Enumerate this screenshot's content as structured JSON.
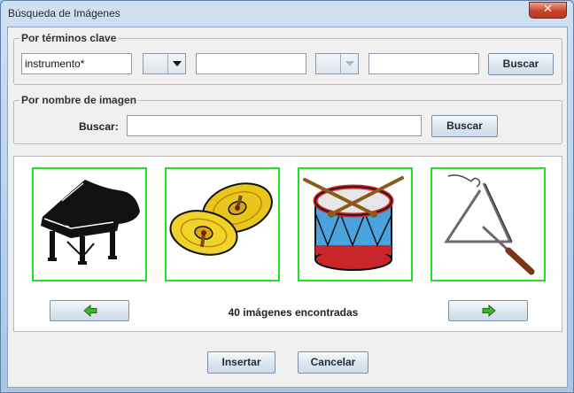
{
  "window": {
    "title": "Búsqueda de Imágenes",
    "close_label": "✕"
  },
  "keywords_group": {
    "legend": "Por términos clave",
    "field1_value": "instrumento*",
    "field2_value": "",
    "field3_value": "",
    "search_label": "Buscar"
  },
  "name_group": {
    "legend": "Por nombre de imagen",
    "search_prompt": "Buscar:",
    "field_value": "",
    "search_label": "Buscar"
  },
  "results": {
    "status": "40 imágenes encontradas",
    "items": [
      {
        "icon": "grand-piano-icon"
      },
      {
        "icon": "cymbals-icon"
      },
      {
        "icon": "drum-icon"
      },
      {
        "icon": "triangle-icon"
      }
    ],
    "selection_color": "#22e022",
    "prev_icon": "arrow-left-icon",
    "next_icon": "arrow-right-icon"
  },
  "footer": {
    "insert_label": "Insertar",
    "cancel_label": "Cancelar"
  }
}
